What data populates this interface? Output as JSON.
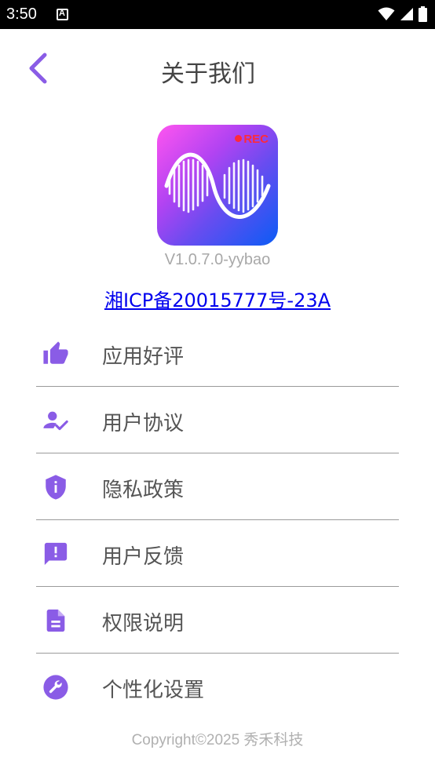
{
  "status_bar": {
    "time": "3:50",
    "icons": [
      "notification-a-icon",
      "wifi-icon",
      "cellular-signal-icon",
      "battery-icon"
    ]
  },
  "header": {
    "title": "关于我们",
    "back_icon": "chevron-left-icon"
  },
  "app": {
    "logo_badge": "REC",
    "version": "V1.0.7.0-yybao",
    "icp": "湘ICP备20015777号-23A"
  },
  "menu": {
    "items": [
      {
        "label": "应用好评",
        "icon": "thumbs-up-icon"
      },
      {
        "label": "用户协议",
        "icon": "user-check-icon"
      },
      {
        "label": "隐私政策",
        "icon": "shield-info-icon"
      },
      {
        "label": "用户反馈",
        "icon": "feedback-icon"
      },
      {
        "label": "权限说明",
        "icon": "document-icon"
      },
      {
        "label": "个性化设置",
        "icon": "wrench-icon"
      }
    ]
  },
  "footer": {
    "copyright": "Copyright©2025 秀禾科技"
  },
  "colors": {
    "accent": "#8a5ce6",
    "status_bar": "#000000",
    "link": "#0000ee",
    "divider": "#9a9a9a"
  }
}
